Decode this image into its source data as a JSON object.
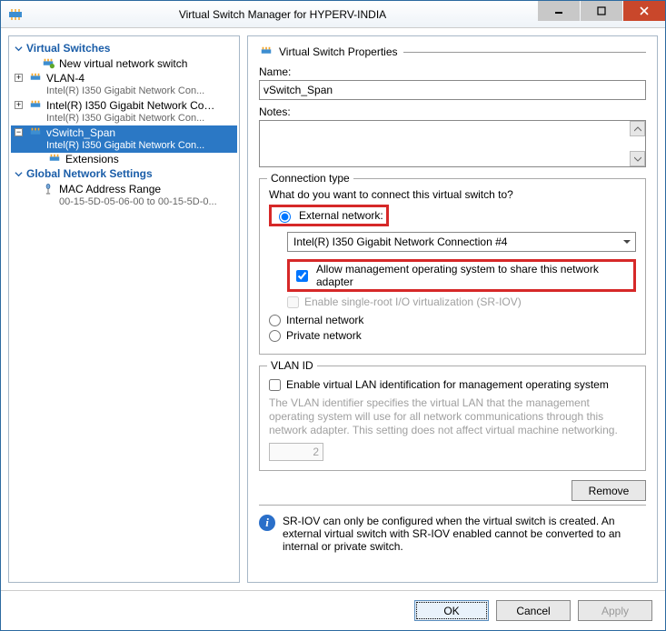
{
  "window": {
    "title": "Virtual Switch Manager for HYPERV-INDIA"
  },
  "tree": {
    "section1": "Virtual Switches",
    "new_switch": "New virtual network switch",
    "items": [
      {
        "name": "VLAN-4",
        "sub": "Intel(R) I350 Gigabit Network Con..."
      },
      {
        "name": "Intel(R) I350 Gigabit Network Con...",
        "sub": "Intel(R) I350 Gigabit Network Con..."
      },
      {
        "name": "vSwitch_Span",
        "sub": "Intel(R) I350 Gigabit Network Con..."
      }
    ],
    "child_ext": "Extensions",
    "section2": "Global Network Settings",
    "mac_range": "MAC Address Range",
    "mac_sub": "00-15-5D-05-06-00 to 00-15-5D-0..."
  },
  "props": {
    "header": "Virtual Switch Properties",
    "name_label": "Name:",
    "name_value": "vSwitch_Span",
    "notes_label": "Notes:"
  },
  "conn": {
    "legend": "Connection type",
    "question": "What do you want to connect this virtual switch to?",
    "external": "External network:",
    "adapter": "Intel(R) I350 Gigabit Network Connection #4",
    "allow_mgmt": "Allow management operating system to share this network adapter",
    "sriov": "Enable single-root I/O virtualization (SR-IOV)",
    "internal": "Internal network",
    "private": "Private network"
  },
  "vlan": {
    "legend": "VLAN ID",
    "enable": "Enable virtual LAN identification for management operating system",
    "help": "The VLAN identifier specifies the virtual LAN that the management operating system will use for all network communications through this network adapter. This setting does not affect virtual machine networking.",
    "id_value": "2"
  },
  "buttons": {
    "remove": "Remove",
    "ok": "OK",
    "cancel": "Cancel",
    "apply": "Apply"
  },
  "sriov_info": "SR-IOV can only be configured when the virtual switch is created. An external virtual switch with SR-IOV enabled cannot be converted to an internal or private switch."
}
